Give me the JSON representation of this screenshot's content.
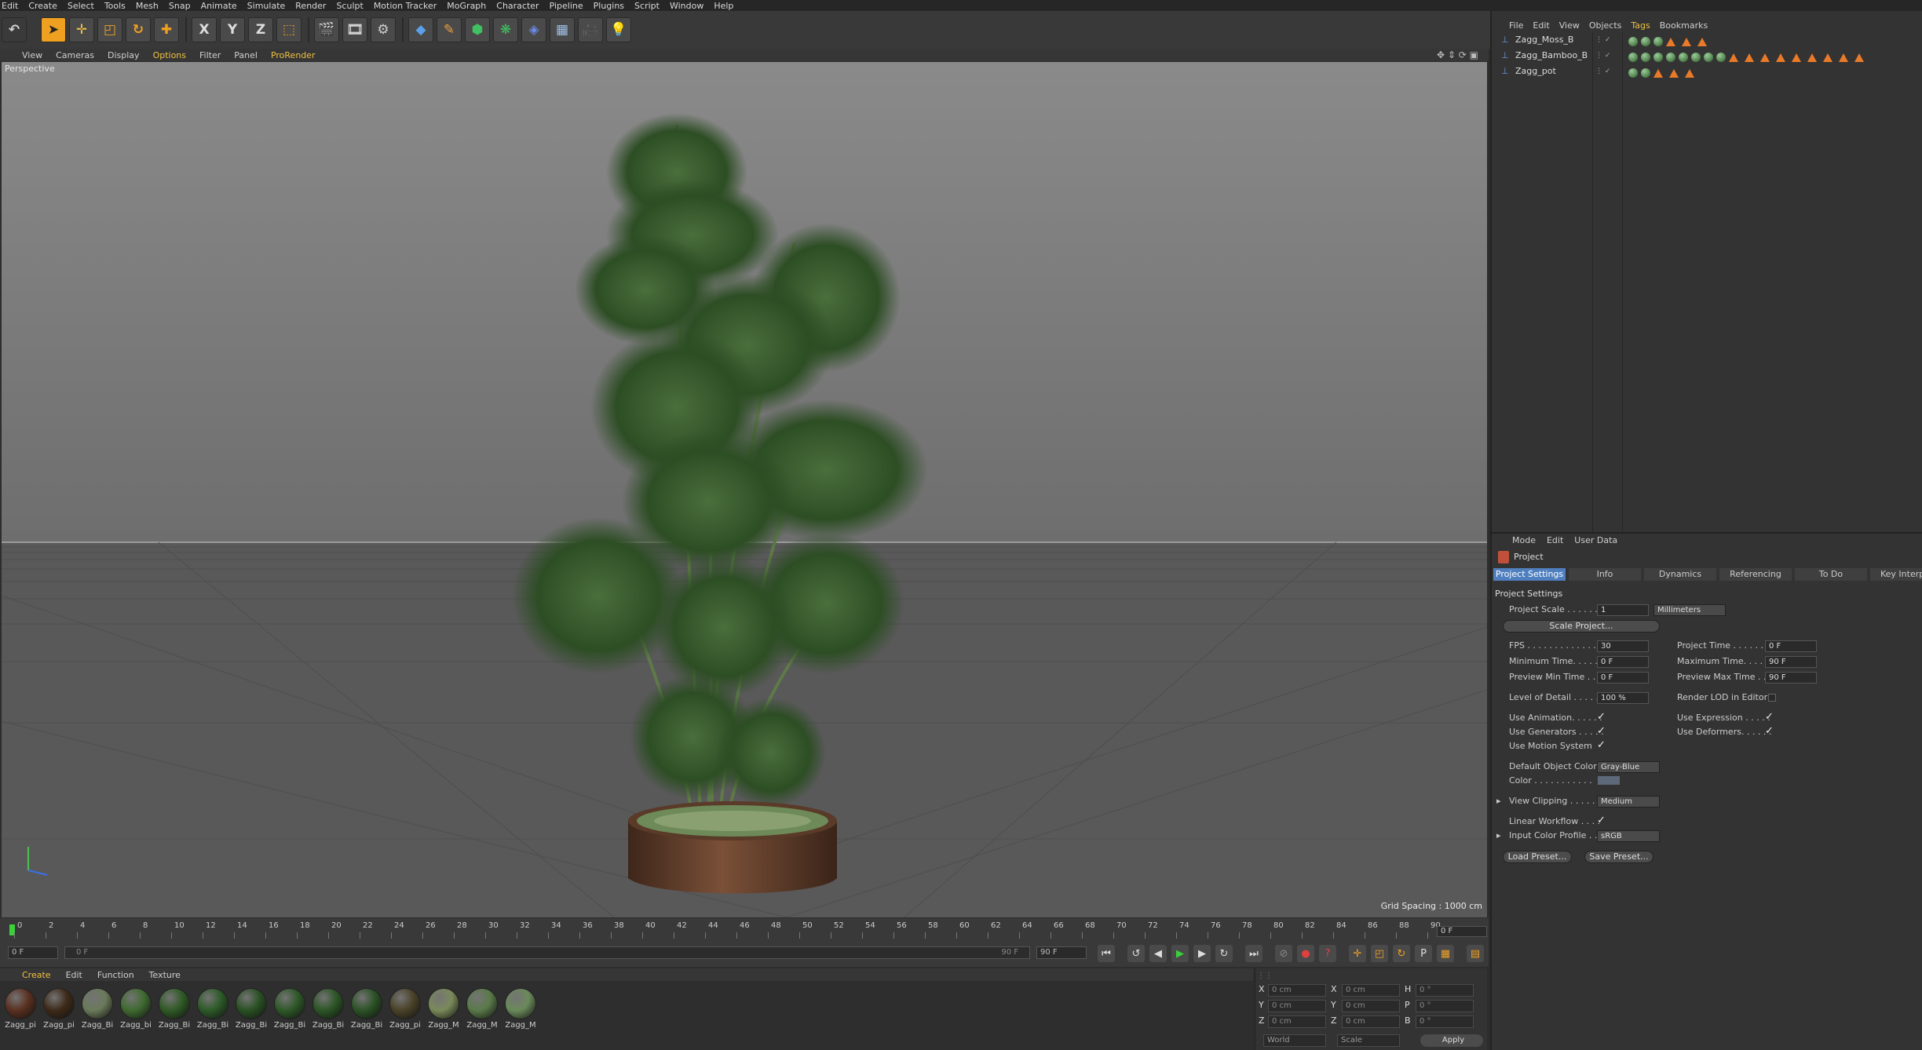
{
  "menubar": [
    "Edit",
    "Create",
    "Select",
    "Tools",
    "Mesh",
    "Snap",
    "Animate",
    "Simulate",
    "Render",
    "Sculpt",
    "Motion Tracker",
    "MoGraph",
    "Character",
    "Pipeline",
    "Plugins",
    "Script",
    "Window",
    "Help"
  ],
  "toolbar": {
    "x_label": "X",
    "y_label": "Y",
    "z_label": "Z"
  },
  "viewport": {
    "menu": [
      "View",
      "Cameras",
      "Display",
      "Options",
      "Filter",
      "Panel",
      "ProRender"
    ],
    "camera_label": "Perspective",
    "grid_spacing": "Grid Spacing : 1000 cm"
  },
  "timeline": {
    "ticks": [
      "0",
      "2",
      "4",
      "6",
      "8",
      "10",
      "12",
      "14",
      "16",
      "18",
      "20",
      "22",
      "24",
      "26",
      "28",
      "30",
      "32",
      "34",
      "36",
      "38",
      "40",
      "42",
      "44",
      "46",
      "48",
      "50",
      "52",
      "54",
      "56",
      "58",
      "60",
      "62",
      "64",
      "66",
      "68",
      "70",
      "72",
      "74",
      "76",
      "78",
      "80",
      "82",
      "84",
      "86",
      "88",
      "90"
    ],
    "current_frame": "0 F",
    "start_field": "0 F",
    "range_start": "0 F",
    "range_end": "90 F",
    "end_field": "90 F"
  },
  "materials": {
    "menu": [
      "Create",
      "Edit",
      "Function",
      "Texture"
    ],
    "items": [
      {
        "label": "Zagg_pi",
        "color": "#5a3020"
      },
      {
        "label": "Zagg_pi",
        "color": "#3d2a18"
      },
      {
        "label": "Zagg_Bi",
        "color": "#6a7a5a"
      },
      {
        "label": "Zagg_bi",
        "color": "#3f6a30"
      },
      {
        "label": "Zagg_Bi",
        "color": "#2f5a25"
      },
      {
        "label": "Zagg_Bi",
        "color": "#2d5a28"
      },
      {
        "label": "Zagg_Bi",
        "color": "#2a5024"
      },
      {
        "label": "Zagg_Bi",
        "color": "#2e5828"
      },
      {
        "label": "Zagg_Bi",
        "color": "#2c5526"
      },
      {
        "label": "Zagg_Bi",
        "color": "#2b5226"
      },
      {
        "label": "Zagg_pi",
        "color": "#4a4228"
      },
      {
        "label": "Zagg_M",
        "color": "#7a8a5a"
      },
      {
        "label": "Zagg_M",
        "color": "#5a7a4a"
      },
      {
        "label": "Zagg_M",
        "color": "#6a8a5a"
      }
    ]
  },
  "coords": {
    "rows": [
      {
        "a": "X",
        "av": "0 cm",
        "b": "X",
        "bv": "0 cm",
        "c": "H",
        "cv": "0 °"
      },
      {
        "a": "Y",
        "av": "0 cm",
        "b": "Y",
        "bv": "0 cm",
        "c": "P",
        "cv": "0 °"
      },
      {
        "a": "Z",
        "av": "0 cm",
        "b": "Z",
        "bv": "0 cm",
        "c": "B",
        "cv": "0 °"
      }
    ],
    "world": "World",
    "scale": "Scale",
    "apply": "Apply"
  },
  "objects": {
    "menu": [
      "File",
      "Edit",
      "View",
      "Objects",
      "Tags",
      "Bookmarks"
    ],
    "items": [
      {
        "name": "Zagg_Moss_B"
      },
      {
        "name": "Zagg_Bamboo_B"
      },
      {
        "name": "Zagg_pot"
      }
    ]
  },
  "attributes": {
    "menu": [
      "Mode",
      "Edit",
      "User Data"
    ],
    "header": "Project",
    "tabs": [
      "Project Settings",
      "Info",
      "Dynamics",
      "Referencing",
      "To Do",
      "Key Interpol"
    ],
    "section": "Project Settings",
    "project_scale_label": "Project Scale . . . . . .",
    "project_scale_value": "1",
    "project_scale_unit": "Millimeters",
    "scale_project_btn": "Scale Project...",
    "fps_label": "FPS . . . . . . . . . . . . . .",
    "fps_value": "30",
    "min_time_label": "Minimum Time. . . . .",
    "min_time_value": "0 F",
    "prev_min_label": "Preview Min Time . .",
    "prev_min_value": "0 F",
    "proj_time_label": "Project Time . . . . . . . .",
    "proj_time_value": "0 F",
    "max_time_label": "Maximum Time. . . . . .",
    "max_time_value": "90 F",
    "prev_max_label": "Preview Max Time . .",
    "prev_max_value": "90 F",
    "lod_label": "Level of Detail . . . . .",
    "lod_value": "100 %",
    "render_lod_label": "Render LOD in Editor",
    "use_anim_label": "Use Animation. . . . . .",
    "use_gen_label": "Use Generators . . . . .",
    "use_motion_label": "Use Motion System",
    "use_expr_label": "Use Expression . . . . .",
    "use_def_label": "Use Deformers. . . . . .",
    "def_color_label": "Default Object Color",
    "def_color_value": "Gray-Blue",
    "color_label": "Color . . . . . . . . . . .",
    "view_clip_label": "View Clipping . . . . . .",
    "view_clip_value": "Medium",
    "linear_label": "Linear Workflow . . . .",
    "input_profile_label": "Input Color Profile . .",
    "input_profile_value": "sRGB",
    "load_preset": "Load Preset...",
    "save_preset": "Save Preset..."
  }
}
